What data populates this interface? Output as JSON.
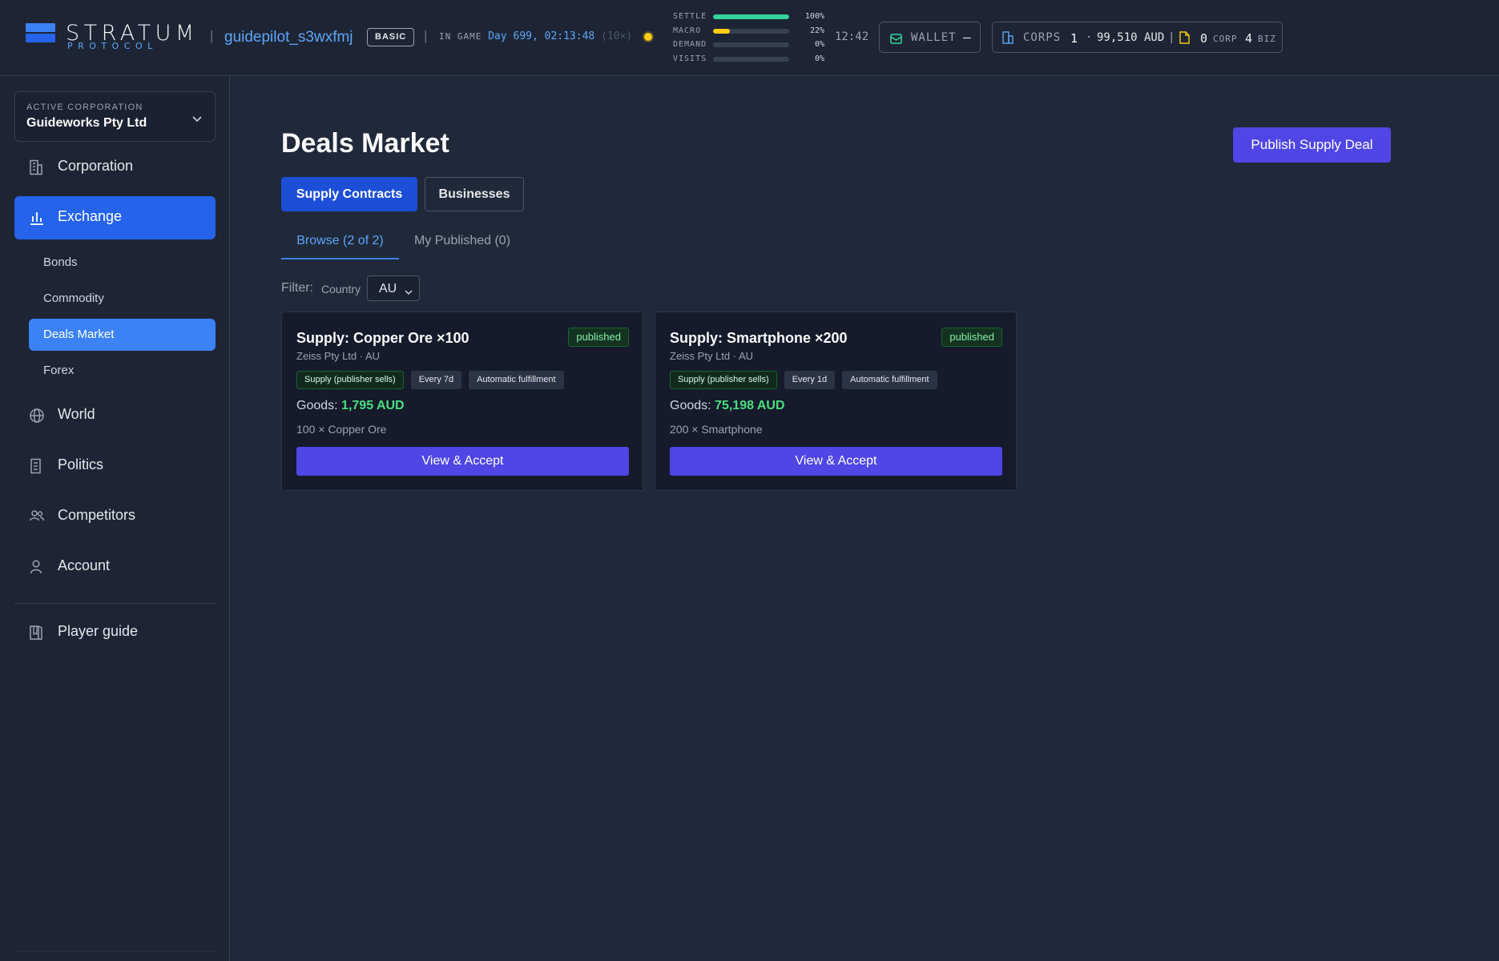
{
  "app": {
    "logo_title": "STRATUM",
    "logo_subtitle": "PROTOCOL"
  },
  "header": {
    "username": "guidepilot_s3wxfmj",
    "plan": "BASIC",
    "in_game_label": "IN GAME",
    "in_game_time": "Day 699, 02:13:48",
    "speed": "(10×)",
    "clock": "12:42",
    "meters": [
      {
        "label": "SETTLE",
        "value": "100%",
        "fraction": 1.0,
        "color": "#34d399"
      },
      {
        "label": "MACRO",
        "value": "22%",
        "fraction": 0.22,
        "color": "#facc15"
      },
      {
        "label": "DEMAND",
        "value": "0%",
        "fraction": 0.0,
        "color": "#60a5fa"
      },
      {
        "label": "VISITS",
        "value": "0%",
        "fraction": 0.0,
        "color": "#60a5fa"
      }
    ],
    "wallet": {
      "label": "WALLET",
      "value": "–"
    },
    "corps": {
      "label": "CORPS",
      "count": "1",
      "dot": "·",
      "balance": "99,510 AUD",
      "divider": "|",
      "corp_docs": "0",
      "corp_docs_label": "CORP",
      "biz_count": "4",
      "biz_label": "BIZ"
    }
  },
  "sidebar": {
    "active_corp_caption": "ACTIVE CORPORATION",
    "active_corp_name": "Guideworks Pty Ltd",
    "items": [
      {
        "label": "Corporation",
        "icon": "building-icon"
      },
      {
        "label": "Exchange",
        "icon": "bar-chart-icon",
        "active": true
      },
      {
        "label": "World",
        "icon": "globe-icon"
      },
      {
        "label": "Politics",
        "icon": "bank-icon"
      },
      {
        "label": "Competitors",
        "icon": "users-icon"
      },
      {
        "label": "Account",
        "icon": "user-icon"
      },
      {
        "label": "Player guide",
        "icon": "book-icon"
      }
    ],
    "exchange_sub": [
      {
        "label": "Bonds"
      },
      {
        "label": "Commodity"
      },
      {
        "label": "Deals Market",
        "active": true
      },
      {
        "label": "Forex"
      }
    ]
  },
  "main": {
    "title": "Deals Market",
    "publish_button": "Publish Supply Deal",
    "segments": [
      {
        "label": "Supply Contracts",
        "active": true
      },
      {
        "label": "Businesses",
        "active": false
      }
    ],
    "subtabs": [
      {
        "label": "Browse (2 of 2)",
        "active": true
      },
      {
        "label": "My Published (0)",
        "active": false
      }
    ],
    "filter": {
      "label": "Filter:",
      "field_label": "Country",
      "selected": "AU"
    },
    "deals": [
      {
        "title": "Supply: Copper Ore ×100",
        "status": "published",
        "publisher": "Zeiss Pty Ltd · AU",
        "tags": [
          "Supply (publisher sells)",
          "Every 7d",
          "Automatic fulfillment"
        ],
        "goods_label": "Goods:",
        "goods_value": "1,795 AUD",
        "quantity": "100 × Copper Ore",
        "action": "View & Accept"
      },
      {
        "title": "Supply: Smartphone ×200",
        "status": "published",
        "publisher": "Zeiss Pty Ltd · AU",
        "tags": [
          "Supply (publisher sells)",
          "Every 1d",
          "Automatic fulfillment"
        ],
        "goods_label": "Goods:",
        "goods_value": "75,198 AUD",
        "quantity": "200 × Smartphone",
        "action": "View & Accept"
      }
    ]
  }
}
